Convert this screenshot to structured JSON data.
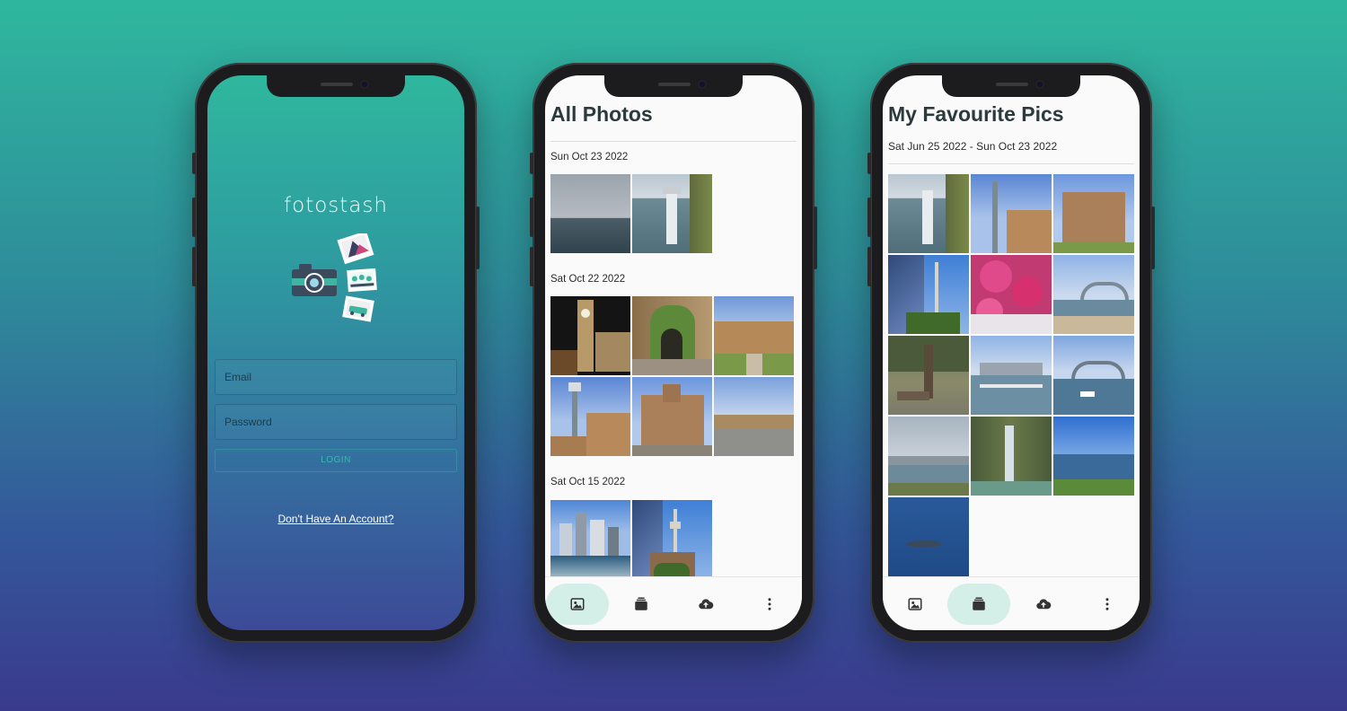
{
  "login": {
    "app_name": "fotostash",
    "email_placeholder": "Email",
    "password_placeholder": "Password",
    "login_label": "LOGIN",
    "signup_link": "Don't Have An Account?"
  },
  "all_photos": {
    "title": "All Photos",
    "groups": [
      {
        "date": "Sun Oct 23 2022"
      },
      {
        "date": "Sat Oct 22 2022"
      },
      {
        "date": "Sat Oct 15 2022"
      }
    ]
  },
  "favourites": {
    "title": "My Favourite Pics",
    "date_range": "Sat Jun 25 2022 - Sun Oct 23 2022"
  },
  "nav": {
    "items": [
      {
        "icon": "photos-icon"
      },
      {
        "icon": "albums-icon"
      },
      {
        "icon": "upload-icon"
      },
      {
        "icon": "more-icon"
      }
    ]
  },
  "colors": {
    "accent": "#2fb79e",
    "nav_active": "#d4efe7",
    "login_button_text": "#38b8b0"
  }
}
